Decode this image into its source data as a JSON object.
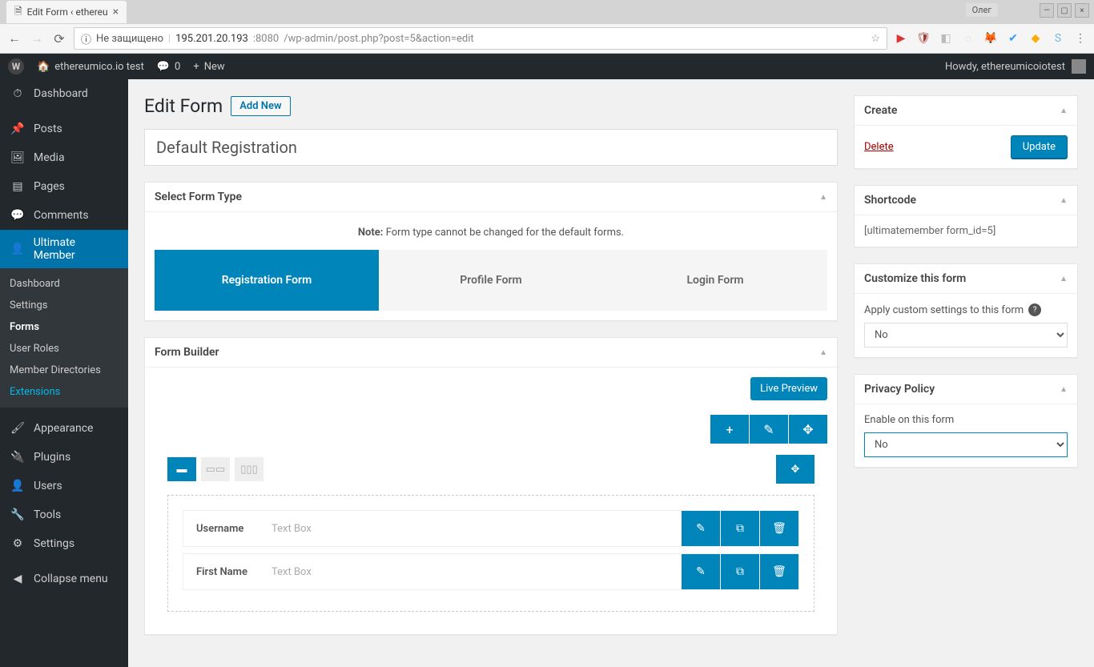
{
  "browser": {
    "tab_title": "Edit Form ‹ ethereu",
    "user_chip": "Олег",
    "url_security": "Не защищено",
    "url_host": "195.201.20.193",
    "url_port": ":8080",
    "url_path": "/wp-admin/post.php?post=5&action=edit"
  },
  "adminbar": {
    "site_name": "ethereumico.io test",
    "comment_count": "0",
    "new_label": "New",
    "howdy": "Howdy, ethereumicoiotest"
  },
  "sidebar": {
    "dashboard": "Dashboard",
    "posts": "Posts",
    "media": "Media",
    "pages": "Pages",
    "comments": "Comments",
    "ultimate_member": "Ultimate Member",
    "sub": {
      "dashboard": "Dashboard",
      "settings": "Settings",
      "forms": "Forms",
      "user_roles": "User Roles",
      "member_directories": "Member Directories",
      "extensions": "Extensions"
    },
    "appearance": "Appearance",
    "plugins": "Plugins",
    "users": "Users",
    "tools": "Tools",
    "settings2": "Settings",
    "collapse": "Collapse menu"
  },
  "page": {
    "title": "Edit Form",
    "add_new": "Add New",
    "form_title": "Default Registration"
  },
  "select_form_type": {
    "header": "Select Form Type",
    "note_bold": "Note:",
    "note_text": " Form type cannot be changed for the default forms.",
    "types": [
      "Registration Form",
      "Profile Form",
      "Login Form"
    ]
  },
  "form_builder": {
    "header": "Form Builder",
    "live_preview": "Live Preview",
    "fields": [
      {
        "label": "Username",
        "type": "Text Box"
      },
      {
        "label": "First Name",
        "type": "Text Box"
      }
    ]
  },
  "side": {
    "create": {
      "header": "Create",
      "delete": "Delete",
      "update": "Update"
    },
    "shortcode": {
      "header": "Shortcode",
      "value": "[ultimatemember form_id=5]"
    },
    "customize": {
      "header": "Customize this form",
      "label": "Apply custom settings to this form",
      "value": "No"
    },
    "privacy": {
      "header": "Privacy Policy",
      "label": "Enable on this form",
      "value": "No"
    }
  }
}
